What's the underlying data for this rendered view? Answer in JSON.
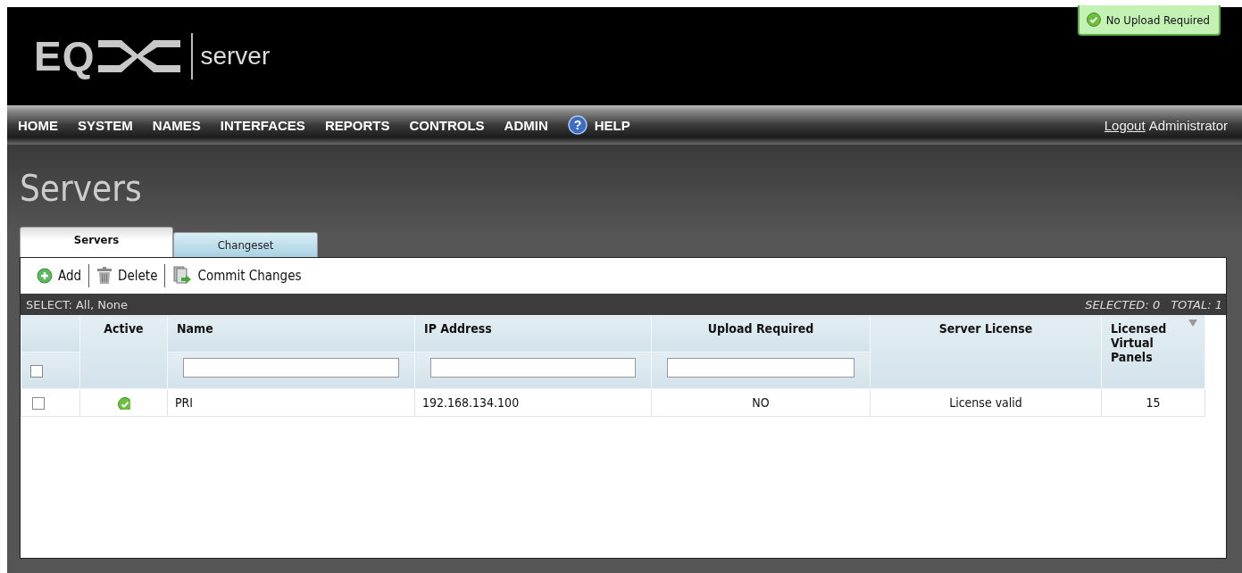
{
  "header": {
    "logo": "EQ",
    "product": "server",
    "upload_status": {
      "text": "No Upload Required",
      "ok": true
    }
  },
  "nav": {
    "items": [
      {
        "label": "HOME",
        "kind": "plain"
      },
      {
        "label": "SYSTEM",
        "kind": "plain"
      },
      {
        "label": "NAMES",
        "kind": "plain"
      },
      {
        "label": "INTERFACES",
        "kind": "plain"
      },
      {
        "label": "REPORTS",
        "kind": "plain"
      },
      {
        "label": "CONTROLS",
        "kind": "plain"
      },
      {
        "label": "ADMIN",
        "kind": "plain"
      },
      {
        "label": "HELP",
        "kind": "help",
        "icon": "?"
      }
    ],
    "logout": "Logout",
    "user": "Administrator"
  },
  "page_title": "Servers",
  "tabs": [
    {
      "label": "Servers",
      "selected": true
    },
    {
      "label": "Changeset",
      "selected": false
    }
  ],
  "toolbar": [
    {
      "label": "Add",
      "kind": "add"
    },
    {
      "label": "Delete",
      "kind": "delete"
    },
    {
      "label": "Commit Changes",
      "kind": "commit"
    }
  ],
  "select_bar": {
    "label": "SELECT:",
    "all": "All",
    "separator": ",",
    "none": "None",
    "selected": "SELECTED: 0",
    "total": "TOTAL: 1"
  },
  "table": {
    "select_all_checked": false,
    "columns": [
      {
        "label": "Active",
        "kind": "plain"
      },
      {
        "label": "Name",
        "kind": "filter"
      },
      {
        "label": "IP Address",
        "kind": "filter"
      },
      {
        "label": "Upload Required",
        "kind": "filter"
      },
      {
        "label": "Server License",
        "kind": "plain"
      },
      {
        "label": "Licensed Virtual Panels",
        "kind": "sortable"
      }
    ],
    "rows": [
      {
        "checked": false,
        "active": true,
        "name": "PRI",
        "ip_address": "192.168.134.100",
        "upload_required": "NO",
        "server_license": "License valid",
        "licensed_virtual_panels": "15"
      }
    ]
  }
}
